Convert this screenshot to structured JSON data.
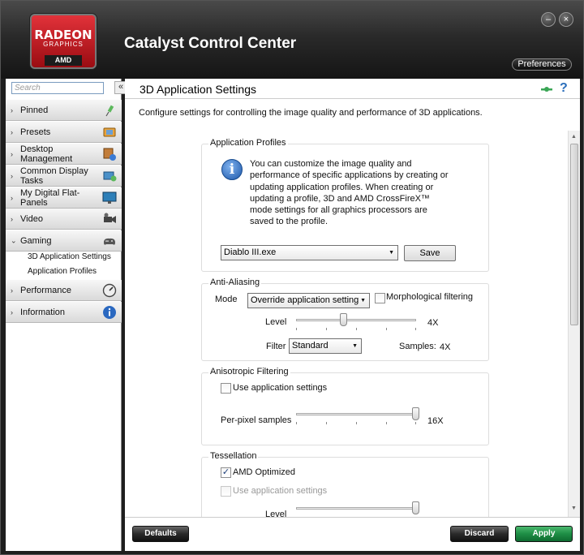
{
  "window": {
    "app_title": "Catalyst Control Center",
    "logo": {
      "line1": "RADEON",
      "line2": "GRAPHICS",
      "line3": "AMD"
    },
    "minimize_glyph": "–",
    "close_glyph": "×",
    "preferences_label": "Preferences"
  },
  "sidebar": {
    "search_placeholder": "Search",
    "collapse_glyph": "«",
    "items": [
      {
        "label": "Pinned",
        "icon": "pin-icon",
        "expanded": false
      },
      {
        "label": "Presets",
        "icon": "presets-icon",
        "expanded": false
      },
      {
        "label": "Desktop Management",
        "label_line1": "Desktop",
        "label_line2": "Management",
        "icon": "desktop-icon",
        "expanded": false
      },
      {
        "label": "Common Display Tasks",
        "label_line1": "Common Display",
        "label_line2": "Tasks",
        "icon": "display-tasks-icon",
        "expanded": false
      },
      {
        "label": "My Digital Flat-Panels",
        "label_line1": "My Digital Flat-",
        "label_line2": "Panels",
        "icon": "monitor-icon",
        "expanded": false
      },
      {
        "label": "Video",
        "icon": "video-camera-icon",
        "expanded": false
      },
      {
        "label": "Gaming",
        "icon": "gamepad-icon",
        "expanded": true,
        "children": [
          "3D Application Settings",
          "Application Profiles"
        ]
      },
      {
        "label": "Performance",
        "icon": "gauge-icon",
        "expanded": false
      },
      {
        "label": "Information",
        "icon": "info-icon",
        "expanded": false
      }
    ],
    "arrow_collapsed": "›",
    "arrow_expanded": "⌄"
  },
  "main": {
    "title": "3D Application Settings",
    "description": "Configure settings for controlling the image quality and performance of 3D applications.",
    "help_glyph": "?",
    "application_profiles": {
      "heading": "Application Profiles",
      "info_glyph": "i",
      "text": "You can customize the image quality and performance of specific applications by creating or updating application profiles. When creating or updating a profile, 3D and AMD CrossFireX™ mode settings for all graphics processors are saved to the profile.",
      "selected_profile": "Diablo III.exe",
      "save_label": "Save"
    },
    "anti_aliasing": {
      "heading": "Anti-Aliasing",
      "mode_label": "Mode",
      "mode_value": "Override application setting",
      "morphological_label": "Morphological filtering",
      "morphological_checked": false,
      "level_label": "Level",
      "level_value": "4X",
      "level_fraction": 0.4,
      "filter_label": "Filter",
      "filter_value": "Standard",
      "samples_label": "Samples:",
      "samples_value": "4X"
    },
    "anisotropic_filtering": {
      "heading": "Anisotropic Filtering",
      "use_app_label": "Use application settings",
      "use_app_checked": false,
      "per_pixel_label": "Per-pixel samples",
      "per_pixel_value": "16X",
      "per_pixel_fraction": 1.0
    },
    "tessellation": {
      "heading": "Tessellation",
      "amd_optimized_label": "AMD Optimized",
      "amd_optimized_checked": true,
      "use_app_label": "Use application settings",
      "use_app_checked": false,
      "level_label": "Level",
      "level_fraction": 1.0
    }
  },
  "footer": {
    "defaults_label": "Defaults",
    "discard_label": "Discard",
    "apply_label": "Apply"
  },
  "colors": {
    "title_bar": "#1e1e1e",
    "apply_green": "#1e8e45",
    "info_blue": "#1c56a8"
  }
}
